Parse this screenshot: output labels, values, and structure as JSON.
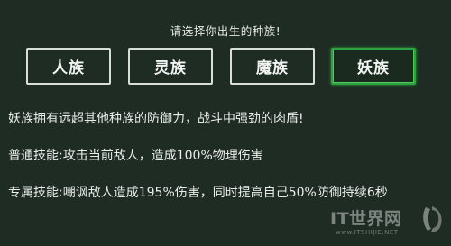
{
  "prompt": "请选择你出生的种族!",
  "races": [
    {
      "label": "人族",
      "selected": false
    },
    {
      "label": "灵族",
      "selected": false
    },
    {
      "label": "魔族",
      "selected": false
    },
    {
      "label": "妖族",
      "selected": true
    }
  ],
  "description": {
    "summary": "妖族拥有远超其他种族的防御力，战斗中强劲的肉盾!",
    "normal_skill": "普通技能:攻击当前敌人，造成100%物理伤害",
    "exclusive_skill": "专属技能:嘲讽敌人造成195%伤害，同时提高自己50%防御持续6秒"
  },
  "watermark": {
    "title": "IT世界网",
    "subtitle": "www.ITSHIJIE.NET"
  },
  "colors": {
    "background": "#1f2c24",
    "button_border": "#d9dedb",
    "selected_border": "#2ea23f",
    "text": "#e9ecea"
  }
}
